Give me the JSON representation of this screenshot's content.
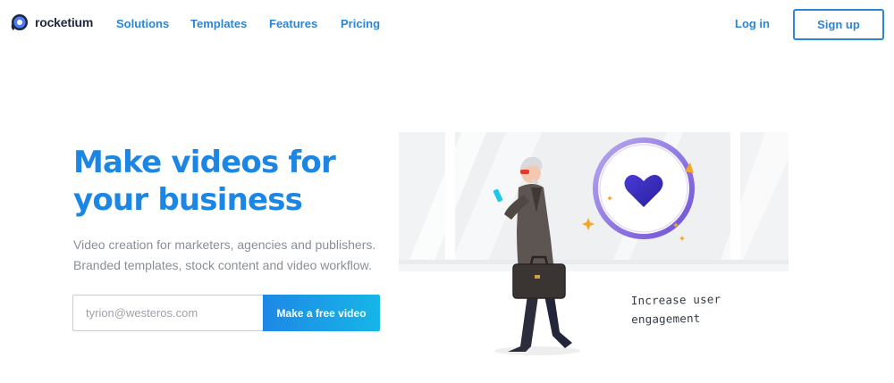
{
  "brand": {
    "name": "rocketium",
    "primary_color": "#1b86e4",
    "link_color": "#2b86d6",
    "dark_color": "#1d2742"
  },
  "nav": {
    "links": [
      {
        "label": "Solutions"
      },
      {
        "label": "Templates"
      },
      {
        "label": "Features"
      },
      {
        "label": "Pricing"
      }
    ],
    "login_label": "Log in",
    "signup_label": "Sign up"
  },
  "hero": {
    "title_lines": [
      "Make videos for",
      "your business"
    ],
    "subtitle_lines": [
      "Video creation for marketers, agencies and publishers.",
      "Branded templates, stock content and video workflow."
    ],
    "email_placeholder": "tyrion@westeros.com",
    "cta_label": "Make a free video",
    "cta_gradient": [
      "#1e88e5",
      "#16b6e8"
    ]
  },
  "illustration": {
    "caption_lines": [
      "Increase user",
      "engagement"
    ],
    "heart_color": "#3d2fc4",
    "ring_color": "#8b6fe0",
    "sparkle_color": "#f5a623"
  }
}
